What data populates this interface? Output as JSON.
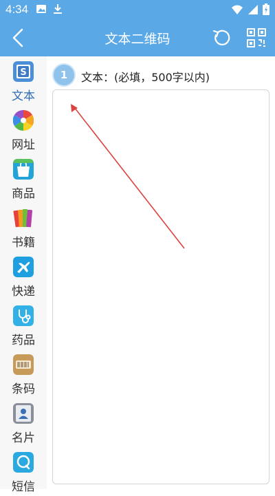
{
  "status_bar": {
    "time": "4:34",
    "left_icons": [
      "image-icon",
      "download-icon"
    ],
    "right_icons": [
      "wifi-icon",
      "signal-icon",
      "battery-icon"
    ]
  },
  "app_bar": {
    "title": "文本二维码",
    "back_icon": "back-arrow-icon",
    "actions": [
      "refresh-icon",
      "qr-code-icon"
    ],
    "color": "#5aa8e6"
  },
  "sidebar": {
    "items": [
      {
        "label": "文本",
        "icon": "text-doc-icon",
        "active": true
      },
      {
        "label": "网址",
        "icon": "pinwheel-icon",
        "active": false
      },
      {
        "label": "商品",
        "icon": "shopping-bag-icon",
        "active": false
      },
      {
        "label": "书籍",
        "icon": "books-icon",
        "active": false
      },
      {
        "label": "快递",
        "icon": "airplane-icon",
        "active": false
      },
      {
        "label": "药品",
        "icon": "stethoscope-icon",
        "active": false
      },
      {
        "label": "条码",
        "icon": "barcode-icon",
        "active": false
      },
      {
        "label": "名片",
        "icon": "contact-card-icon",
        "active": false
      },
      {
        "label": "短信",
        "icon": "message-icon",
        "active": false
      }
    ]
  },
  "form": {
    "step_number": "1",
    "step_label": "文本：(必填，500字以内)",
    "text_value": ""
  },
  "colors": {
    "accent": "#5aa8e6",
    "active_label": "#2f6db3",
    "annotation_arrow": "#d9433f"
  }
}
